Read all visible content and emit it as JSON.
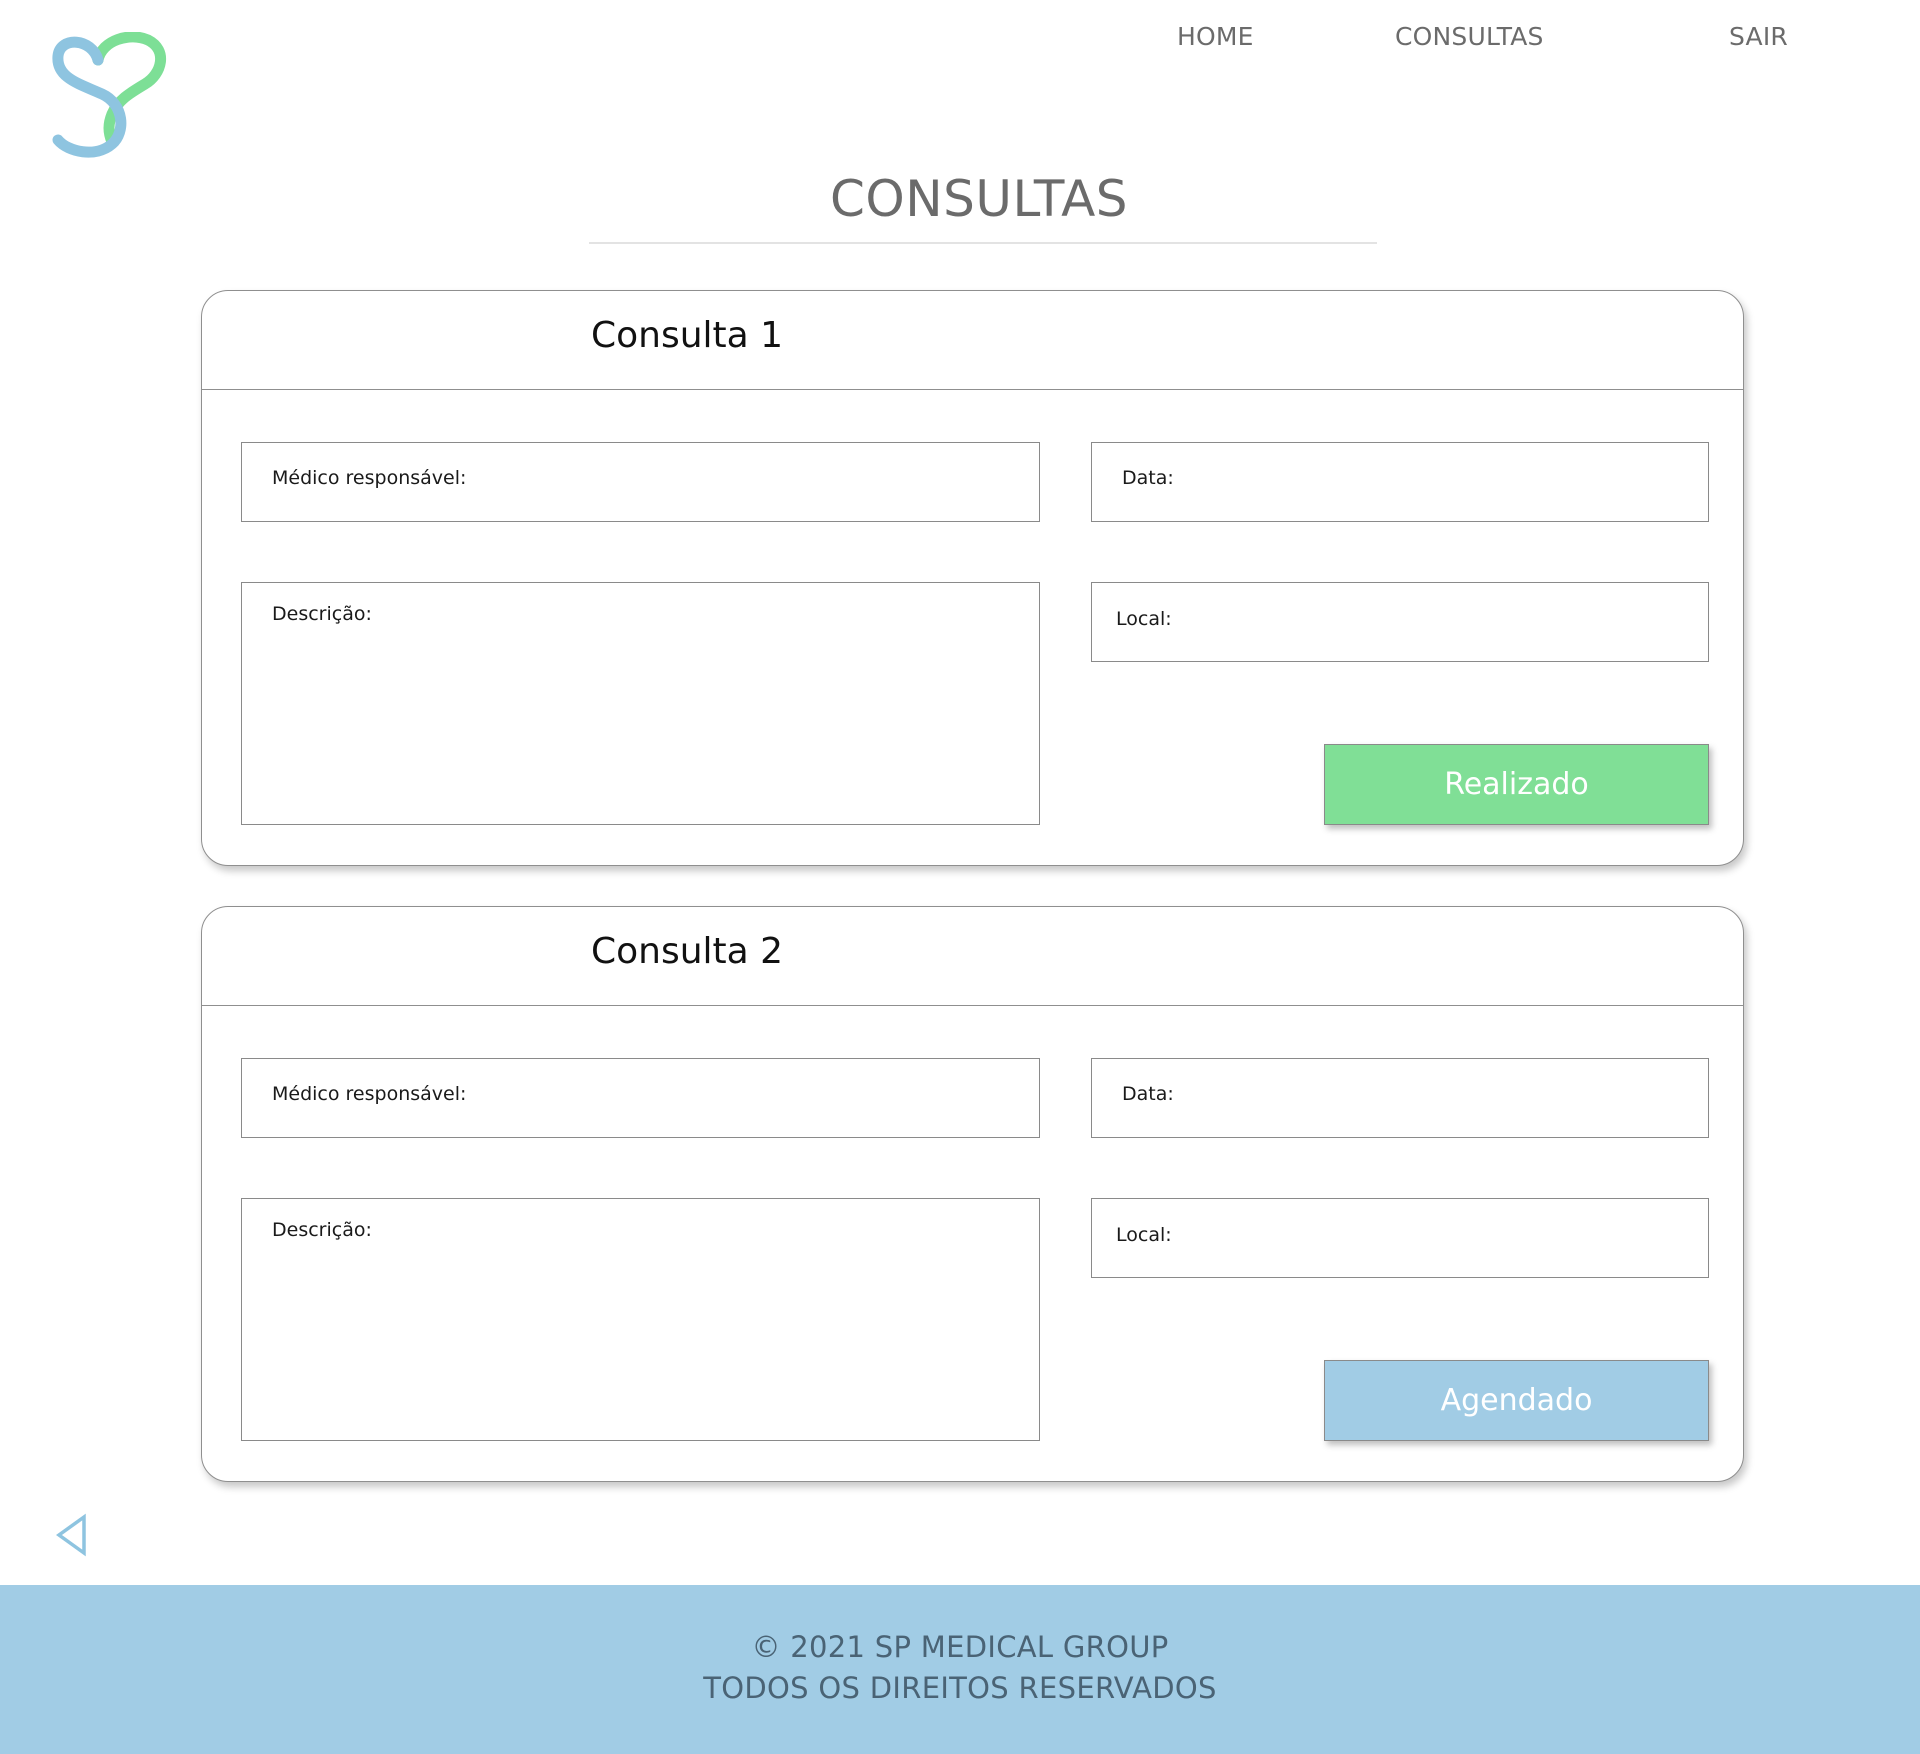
{
  "colors": {
    "logo_blue": "#8ec4e0",
    "logo_green": "#7ddf96",
    "footer_bg": "#a1cce5"
  },
  "header": {
    "logo_icon": "heart-s-logo-icon",
    "nav": {
      "home": "HOME",
      "consultas": "CONSULTAS",
      "sair": "SAIR"
    }
  },
  "page": {
    "title": "CONSULTAS"
  },
  "consultas": [
    {
      "title": "Consulta 1",
      "medico_label": "Médico responsável:",
      "data_label": "Data:",
      "descricao_label": "Descrição:",
      "local_label": "Local:",
      "status": "Realizado",
      "status_color": "#80df96"
    },
    {
      "title": "Consulta 2",
      "medico_label": "Médico responsável:",
      "data_label": "Data:",
      "descricao_label": "Descrição:",
      "local_label": "Local:",
      "status": "Agendado",
      "status_color": "#a1cce5"
    }
  ],
  "back_icon": "back-triangle-icon",
  "footer": {
    "line1": "© 2021 SP MEDICAL GROUP",
    "line2": "TODOS OS DIREITOS RESERVADOS"
  }
}
